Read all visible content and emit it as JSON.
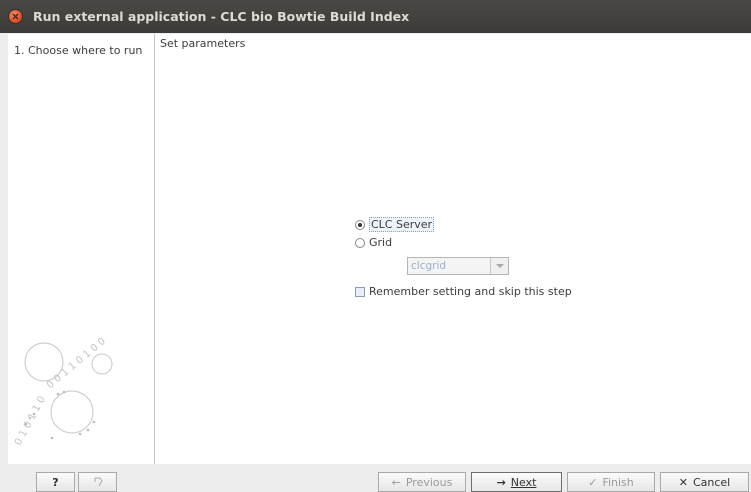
{
  "window": {
    "title": "Run external application - CLC bio Bowtie Build Index"
  },
  "steps": {
    "items": [
      {
        "label": "1.  Choose where to run"
      }
    ]
  },
  "main": {
    "section_title": "Set parameters",
    "options": {
      "clc_server": {
        "label": "CLC Server",
        "selected": true
      },
      "grid": {
        "label": "Grid",
        "selected": false
      },
      "grid_preset": {
        "value": "clcgrid",
        "enabled": false
      },
      "remember": {
        "label": "Remember setting and skip this step",
        "checked": false
      }
    }
  },
  "footer": {
    "help_label": "?",
    "previous_label": "Previous",
    "next_label": "Next",
    "finish_label": "Finish",
    "cancel_label": "Cancel"
  },
  "icons": {
    "close": "close-icon",
    "help": "help-icon",
    "reset": "reset-icon",
    "previous": "arrow-left-icon",
    "next": "arrow-right-icon",
    "finish": "checkmark-icon",
    "cancel": "x-icon"
  },
  "colors": {
    "titlebar": "#3c3b37",
    "close_button": "#e0522b"
  }
}
